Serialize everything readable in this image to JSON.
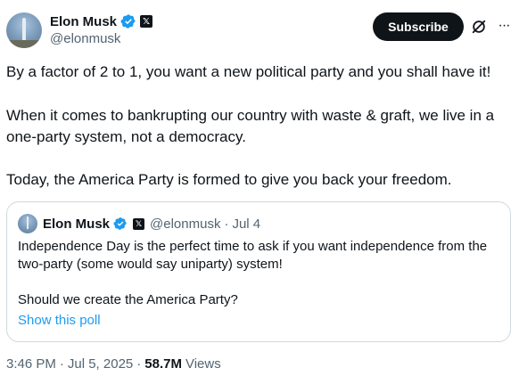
{
  "author": {
    "name": "Elon Musk",
    "handle": "@elonmusk",
    "affiliate_badge": "𝕏"
  },
  "actions": {
    "subscribe_label": "Subscribe",
    "more_label": "···"
  },
  "post": {
    "paragraphs": [
      "By a factor of 2 to 1, you want a new political party and you shall have it!",
      "When it comes to bankrupting our country with waste & graft, we live in a one-party system, not a democracy.",
      "Today, the America Party is formed to give you back your freedom."
    ]
  },
  "quote": {
    "name": "Elon Musk",
    "affiliate_badge": "𝕏",
    "handle": "@elonmusk",
    "separator": "·",
    "date": "Jul 4",
    "paragraphs": [
      "Independence Day is the perfect time to ask if you want independence from the two-party (some would say uniparty) system!",
      "Should we create the America Party?"
    ],
    "poll_link": "Show this poll"
  },
  "meta": {
    "time": "3:46 PM",
    "separator": "·",
    "date": "Jul 5, 2025",
    "separator2": "·",
    "views_count": "58.7M",
    "views_label": "Views"
  },
  "colors": {
    "text": "#0f1419",
    "secondary": "#536471",
    "link": "#1d9bf0",
    "verified": "#1d9bf0",
    "border": "#cfd9de"
  },
  "icons": {
    "verified": "verified-badge-icon",
    "affiliate": "x-logo-icon",
    "grok": "grok-icon",
    "more": "more-dots-icon"
  }
}
